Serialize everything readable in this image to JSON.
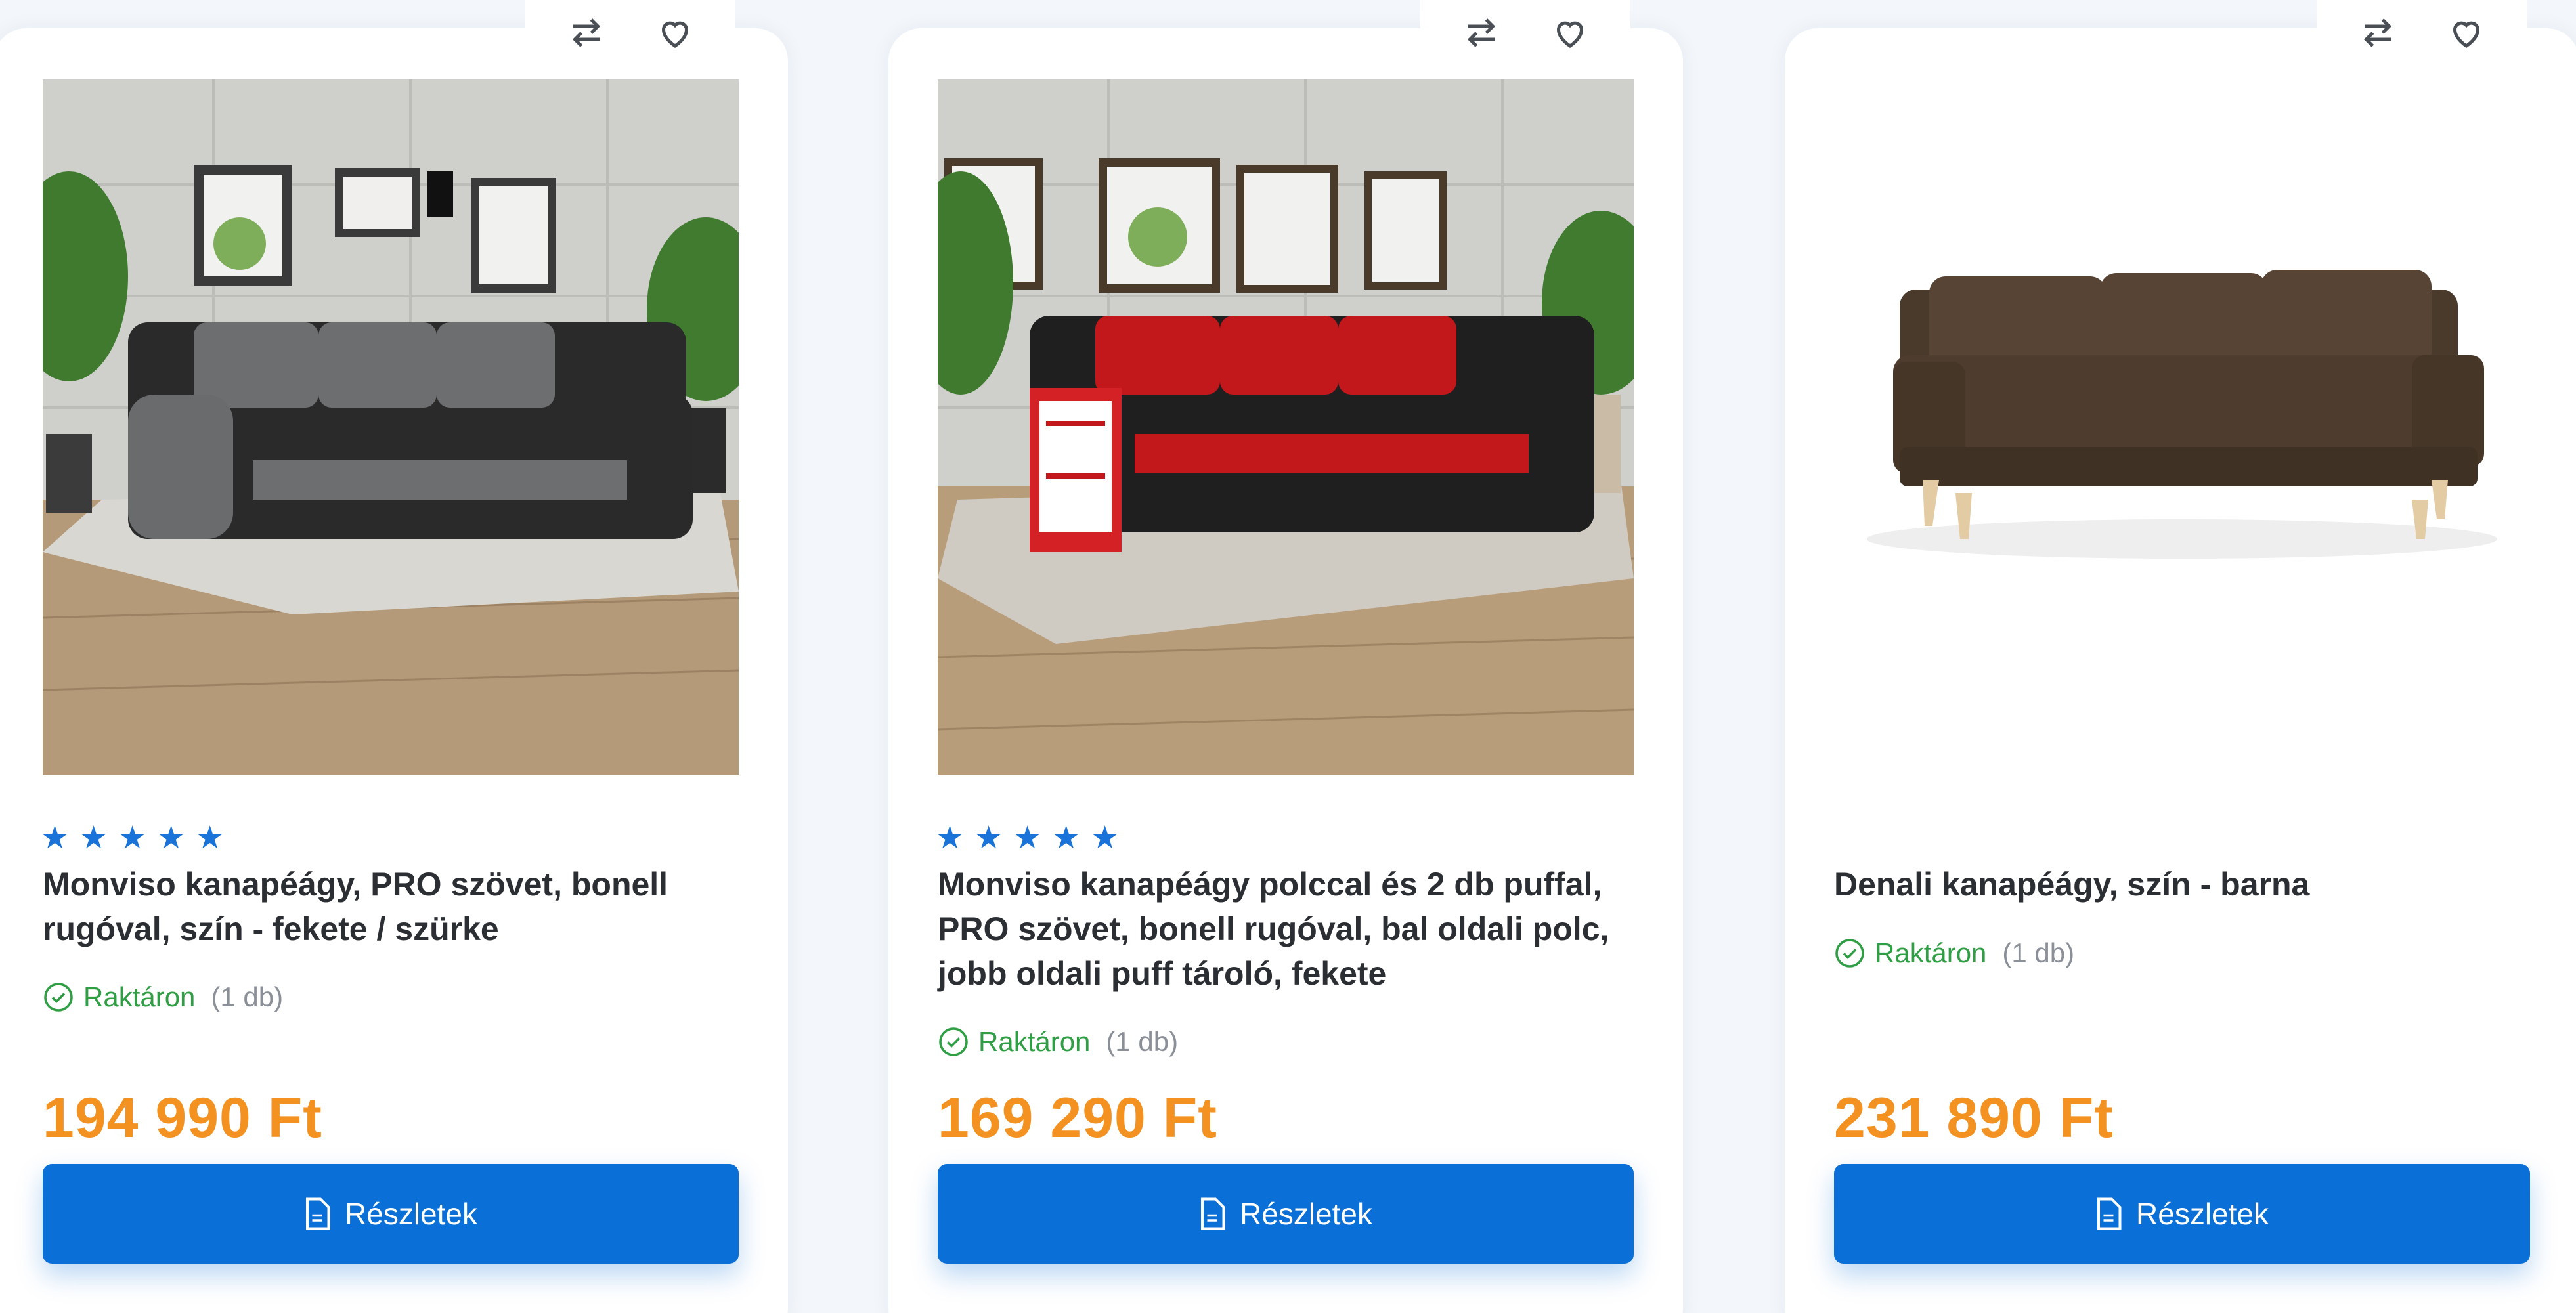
{
  "products": [
    {
      "title": "Monviso kanapéágy, PRO szövet, bonell rugóval, szín - fekete / szürke",
      "rating_stars": 5,
      "stock_label": "Raktáron",
      "stock_qty": "(1 db)",
      "price": "194 990 Ft",
      "button_label": "Részletek",
      "image": "sofa-black-grey",
      "compare_icon": "compare-arrows-icon",
      "wishlist_icon": "heart-icon"
    },
    {
      "title": "Monviso kanapéágy polccal és 2 db puffal, PRO szövet, bonell rugóval, bal oldali polc, jobb oldali puff tároló, fekete",
      "rating_stars": 5,
      "stock_label": "Raktáron",
      "stock_qty": "(1 db)",
      "price": "169 290 Ft",
      "button_label": "Részletek",
      "image": "sofa-black-red-with-shelf",
      "compare_icon": "compare-arrows-icon",
      "wishlist_icon": "heart-icon"
    },
    {
      "title": "Denali kanapéágy, szín - barna",
      "rating_stars": 0,
      "stock_label": "Raktáron",
      "stock_qty": "(1 db)",
      "price": "231 890 Ft",
      "button_label": "Részletek",
      "image": "sofa-brown",
      "compare_icon": "compare-arrows-icon",
      "wishlist_icon": "heart-icon"
    }
  ],
  "colors": {
    "accent_blue": "#0a6fd6",
    "price_orange": "#f39220",
    "stock_green": "#2f9e44",
    "star_blue": "#1a73d9"
  }
}
